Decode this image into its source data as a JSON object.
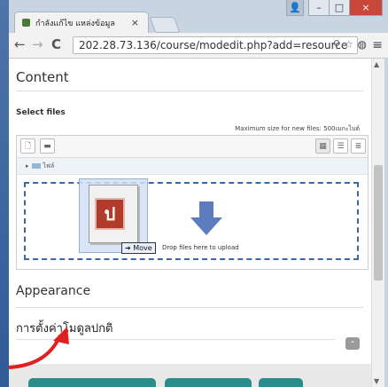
{
  "browser": {
    "tab_title": "กำลังแก้ไข แหล่งข้อมูล",
    "tab_close": "×",
    "window_user": "👤",
    "window_minimize": "–",
    "window_maximize": "□",
    "window_close": "×",
    "address": "202.28.73.136/course/modedit.php?add=resource",
    "address_icons": "⚲ ☆"
  },
  "page": {
    "content_heading": "Content",
    "select_files_label": "Select files",
    "max_size_text": "Maximum size for new files: 500เมกะไบต์",
    "path_label": "ไฟล์",
    "drop_text": "Drop files here to upload",
    "move_label": "Move",
    "appearance_heading": "Appearance",
    "module_settings_heading": "การตั้งค่าโมดูลปกติ"
  },
  "colors": {
    "dropzone_border": "#3a67a8",
    "teal_button": "#2a8c8b",
    "annotation_arrow": "#e02020"
  }
}
